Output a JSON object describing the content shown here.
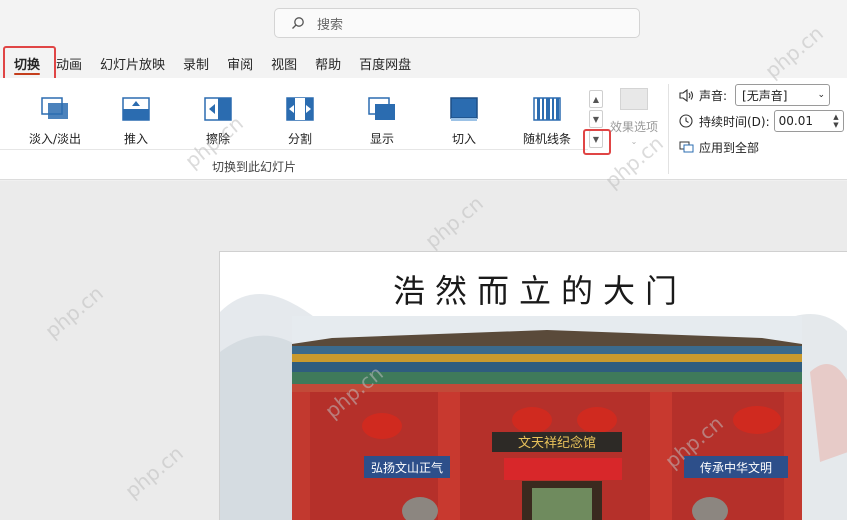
{
  "search": {
    "placeholder": "搜索"
  },
  "tabs": [
    {
      "label": "切换"
    },
    {
      "label": "动画"
    },
    {
      "label": "幻灯片放映"
    },
    {
      "label": "录制"
    },
    {
      "label": "审阅"
    },
    {
      "label": "视图"
    },
    {
      "label": "帮助"
    },
    {
      "label": "百度网盘"
    }
  ],
  "transitions": {
    "items": [
      {
        "label": "淡入/淡出",
        "icon": "fade-icon"
      },
      {
        "label": "推入",
        "icon": "push-icon"
      },
      {
        "label": "擦除",
        "icon": "wipe-icon"
      },
      {
        "label": "分割",
        "icon": "split-icon"
      },
      {
        "label": "显示",
        "icon": "reveal-icon"
      },
      {
        "label": "切入",
        "icon": "cut-icon"
      },
      {
        "label": "随机线条",
        "icon": "random-bars-icon"
      }
    ],
    "group_label": "切换到此幻灯片",
    "effect_options_label": "效果选项"
  },
  "timing": {
    "sound_label": "声音:",
    "sound_value": "[无声音]",
    "duration_label": "持续时间(D):",
    "duration_value": "00.01",
    "apply_all_label": "应用到全部"
  },
  "slide": {
    "title": "浩然而立的大门",
    "gate_plaque": "文天祥纪念馆",
    "banner_left": "弘扬文山正气",
    "banner_right": "传承中华文明"
  },
  "watermark": "php.cn",
  "colors": {
    "accent": "#c43e1c",
    "highlight": "#e04545",
    "icon_blue": "#2b6cb0"
  }
}
